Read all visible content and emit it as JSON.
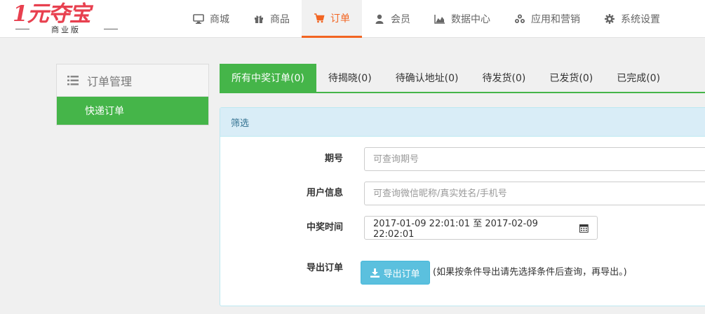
{
  "logo": {
    "brand": "1元夺宝",
    "edition": "商业版"
  },
  "nav": {
    "items": [
      {
        "label": "商城",
        "icon": "monitor-icon"
      },
      {
        "label": "商品",
        "icon": "gift-icon"
      },
      {
        "label": "订单",
        "icon": "cart-icon"
      },
      {
        "label": "会员",
        "icon": "user-icon"
      },
      {
        "label": "数据中心",
        "icon": "area-chart-icon"
      },
      {
        "label": "应用和营销",
        "icon": "cubes-icon"
      },
      {
        "label": "系统设置",
        "icon": "gear-icon"
      }
    ],
    "active_label": "订单"
  },
  "sidebar": {
    "title": "订单管理",
    "items": [
      {
        "label": "快递订单"
      }
    ]
  },
  "tabs": [
    {
      "label": "所有中奖订单(0)"
    },
    {
      "label": "待揭晓(0)"
    },
    {
      "label": "待确认地址(0)"
    },
    {
      "label": "待发货(0)"
    },
    {
      "label": "已发货(0)"
    },
    {
      "label": "已完成(0)"
    }
  ],
  "filter": {
    "title": "筛选",
    "period_label": "期号",
    "period_placeholder": "可查询期号",
    "user_label": "用户信息",
    "user_placeholder": "可查询微信昵称/真实姓名/手机号",
    "time_label": "中奖时间",
    "time_value": "2017-01-09 22:01:01 至 2017-02-09 22:02:01",
    "export_label": "导出订单",
    "export_button": "导出订单",
    "export_hint": "(如果按条件导出请先选择条件后查询，再导出。)"
  },
  "colors": {
    "accent_orange": "#f26522",
    "green": "#45b549",
    "info_blue": "#5bc0de",
    "logo_red": "#e8404f"
  }
}
